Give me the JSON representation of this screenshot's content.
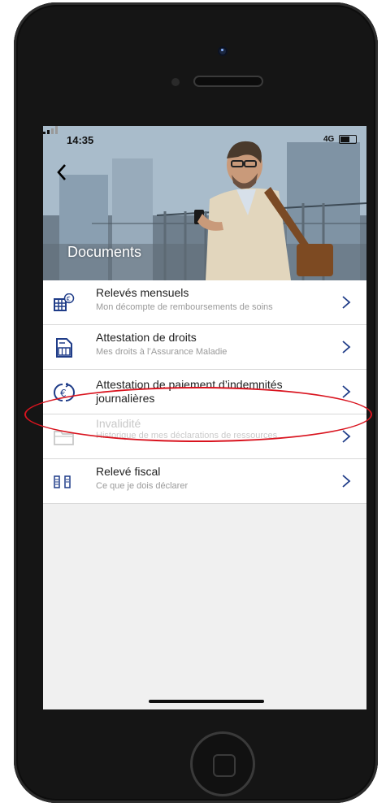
{
  "status": {
    "time": "14:35",
    "network": "4G"
  },
  "header": {
    "title": "Documents"
  },
  "items": [
    {
      "title": "Relevés mensuels",
      "subtitle": "Mon décompte de remboursements de soins",
      "icon": "monthly-statement-icon",
      "enabled": true
    },
    {
      "title": "Attestation de droits",
      "subtitle": "Mes droits à l’Assurance Maladie",
      "icon": "rights-certificate-icon",
      "enabled": true
    },
    {
      "title": "Attestation de paiement d’indemnités journalières",
      "subtitle": "",
      "icon": "euro-refresh-icon",
      "enabled": true,
      "highlighted": true
    },
    {
      "title": "Invalidité",
      "subtitle": "Historique de mes déclarations de ressources",
      "icon": "folder-icon",
      "enabled": false
    },
    {
      "title": "Relevé fiscal",
      "subtitle": "Ce que je dois déclarer",
      "icon": "tax-statement-icon",
      "enabled": true
    }
  ],
  "colors": {
    "accent": "#1f3c88",
    "highlight_circle": "#d9141f",
    "separator": "#d9d9d9"
  }
}
